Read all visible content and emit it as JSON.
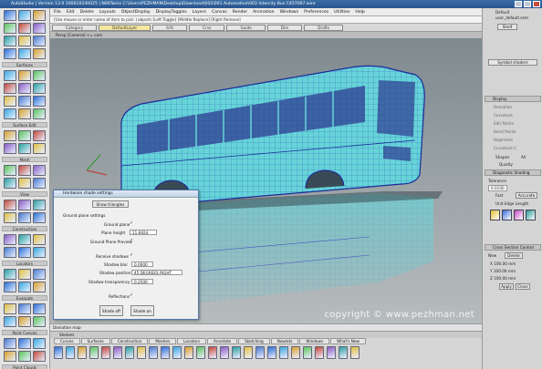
{
  "window": {
    "title": "AutoStudio | Version 13.0 200610240025 | N06Twins C:\\Users\\PEZHMAN\\Desktop\\Download\\002\\001 Automotive\\003 Intercity Bus C457067.wire"
  },
  "menu": [
    "File",
    "Edit",
    "Delete",
    "Layouts",
    "ObjectDisplay",
    "DisplayToggles",
    "Layers",
    "Canvas",
    "Render",
    "Animation",
    "Windows",
    "Preferences",
    "Utilities",
    "Help"
  ],
  "command_line": "[Use mouse or enter name of item to pick ] objects [Left Toggle] [Middle Replace] [Right Remove]",
  "layers": [
    {
      "label": "Category",
      "active": false
    },
    {
      "label": "DefaultLayer",
      "active": true
    },
    {
      "label": "Srfs",
      "active": false
    },
    {
      "label": "Crvs",
      "active": false
    },
    {
      "label": "Guide",
      "active": false
    },
    {
      "label": "Dim",
      "active": false
    },
    {
      "label": "Drafts",
      "active": false
    }
  ],
  "viewport": {
    "title": "Persp [Camera] <= cam",
    "watermark": "copyright © www.pezhman.net"
  },
  "palette": {
    "sections": [
      "Surfaces",
      "Surface Edit",
      "Mesh",
      "View",
      "Construction",
      "Locators",
      "Evaluate",
      "Paint Canvas",
      "Point Clouds"
    ]
  },
  "dialog": {
    "title": "Hardware shade settings",
    "show_triangles": "Show triangles",
    "group_label": "Ground plane settings",
    "ground_plane": "Ground plane",
    "plane_height_label": "Plane height",
    "plane_height_value": "11.6924",
    "ground_plane_preview": "Ground Plane Preview",
    "receive_shadows": "Receive shadows",
    "shadow_blur_label": "Shadow blur",
    "shadow_blur_value": "0.0000",
    "shadow_position_label": "Shadow position",
    "shadow_position_value": "45 DEGREES RIGHT",
    "shadow_transparency_label": "Shadow transparency",
    "shadow_transparency_value": "0.2500",
    "reflections": "Reflections",
    "shade_off": "Shade off",
    "shade_on": "Shade on"
  },
  "right_panel": {
    "default_label": "Default",
    "user_default": "user_default.sem",
    "shelf_tab": "Shelf",
    "symbol_shaders": "Symbol shaders",
    "display_header": "Display",
    "display_items": [
      "Deviation",
      "Curvature",
      "Edit Points",
      "Bend Points",
      "Segments",
      "Curvature C"
    ],
    "shapes_label": "Shapes",
    "shapes_value": "All",
    "quality_label": "Quality",
    "diag_header": "Diagnostic Shading",
    "tolerance_label": "Tolerance",
    "tolerance_value": "0.0100",
    "fast_label": "Fast",
    "accurate_label": "Accurate",
    "unit_edge_label": "Unit Edge Length",
    "cross_header": "Cross Section Control",
    "new_label": "New",
    "delete_label": "Delete",
    "x_label": "X 100.00 mm",
    "y_label": "Y 100.00 mm",
    "z_label": "Z 100.00 mm",
    "apply_label": "Apply",
    "close_label": "Close"
  },
  "status": {
    "text": "Deviation map"
  },
  "shelves": {
    "title": "Shelves",
    "tabs": [
      "Curves",
      "Surfaces",
      "Construction",
      "Meshes",
      "Locators",
      "Annotate",
      "Sketching",
      "Nowlets",
      "Windows",
      "What's New"
    ]
  }
}
